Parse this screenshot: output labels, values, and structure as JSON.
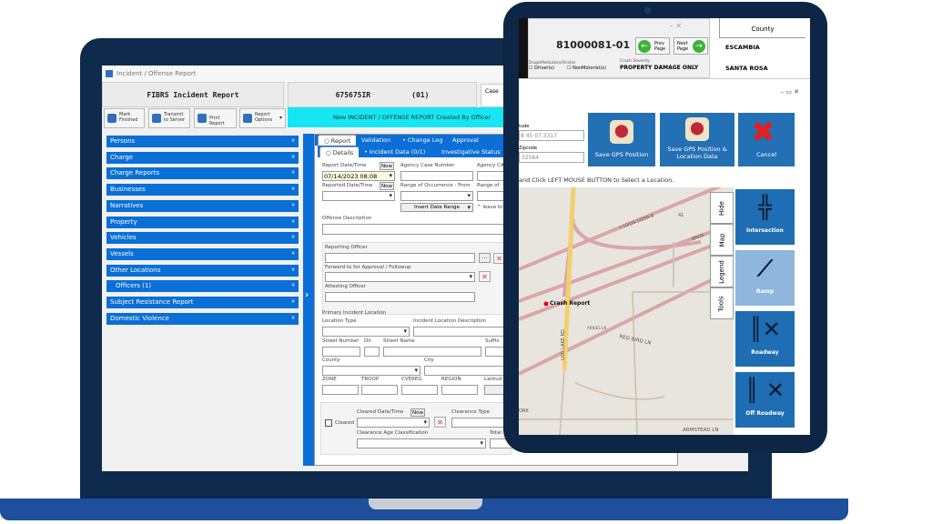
{
  "laptop_app": {
    "window_title": "Incident / Offense Report",
    "report_type": "FIBRS Incident Report",
    "report_number": "675675IR",
    "report_seq": "(01)",
    "case_label": "Case",
    "toolbar": {
      "mark_finished": "Mark Finished",
      "transmit": "Transmit to Server",
      "print": "Print Report",
      "options": "Report Options"
    },
    "banner": "New INCIDENT / OFFENSE REPORT Created By Officer",
    "sections": [
      "Persons",
      "Charge",
      "Charge Reports",
      "Businesses",
      "Narratives",
      "Property",
      "Vehicles",
      "Vessels",
      "Other Locations",
      "Officers (1)",
      "Subject Resistance Report",
      "Domestic Violence"
    ],
    "tabs": [
      "Report",
      "Validation",
      "Change Log",
      "Approval"
    ],
    "subtabs": [
      "Details",
      "Incident Data (0/1)",
      "Investigative Status"
    ],
    "form": {
      "report_datetime_label": "Report Date/Time",
      "report_datetime": "07/14/2023 08:08",
      "now": "Now",
      "agency_case_label": "Agency Case Number",
      "agency_ca_label": "Agency CA",
      "reported_datetime_label": "Reported Date/Time",
      "range_from_label": "Range of Occurrence - From",
      "range_to_label": "Range of",
      "insert_date_range": "Insert Date Range",
      "leave_blank": "^ leave bl",
      "offense_desc_label": "Offense Description",
      "reporting_officer_label": "Reporting Officer",
      "ellipsis": "...",
      "forward_label": "Forward to for Approval / Followup",
      "attesting_label": "Attesting Officer",
      "primary_location_label": "Primary Incident Location",
      "location_type_label": "Location Type",
      "location_desc_label": "Incident Location Description",
      "street_number_label": "Street Number",
      "dir_label": "Dir",
      "street_name_label": "Street Name",
      "suffix_label": "Suffix",
      "county_label": "County",
      "city_label": "City",
      "zone_label": "ZONE",
      "troop_label": "TROOP",
      "cvereg_label": "CVEREG",
      "region_label": "REGION",
      "latitude_label": "Latitud",
      "cleared_label": "Cleared",
      "cleared_datetime_label": "Cleared Date/Time",
      "clearance_type_label": "Clearance Type",
      "clearance_age_label": "Clearance Age Classification",
      "total_label": "Total"
    }
  },
  "tablet_app": {
    "report_number": "81000081-01",
    "prev_page": "Prev Page",
    "next_page": "Next Page",
    "drug_label": "Drugs/Medication/Alcohol",
    "driver": "Driver(s)",
    "nonmotorist": "NonMotorist(s)",
    "crash_severity_label": "Crash Severity",
    "crash_severity": "PROPERTY DAMAGE ONLY",
    "county_header": "County",
    "counties": [
      "ESCAMBIA",
      "SANTA ROSA"
    ],
    "longitude_label": "tude",
    "longitude": "8 45 07.3317",
    "zipcode_label": "Zipcode",
    "zipcode": "32564",
    "save_gps": "Save GPS Position",
    "save_gps_location": "Save GPS Position & Location Data",
    "cancel": "Cancel",
    "instruction": "and Click LEFT MOUSE BUTTON to Select a Location.",
    "map_tabs": [
      "Hide",
      "Map",
      "Legend",
      "Tools"
    ],
    "map_labels": {
      "marker": "Crash Report",
      "road1": "I-10/US-10/SR-8",
      "road2": "LOG LAKE RD",
      "road3": "RED BIRD LN",
      "road4": "ARNIES LN",
      "road5": "ARMSTEAD LN",
      "road6": "BROX",
      "road7": "ORK",
      "road8": "41"
    },
    "tiles": [
      "Intersection",
      "Ramp",
      "Roadway",
      "Off Roadway"
    ]
  },
  "colors": {
    "nav_blue": "#0a6fd6",
    "banner": "#16e6f2",
    "tile_blue": "#1f6db3",
    "bezel": "#0e2a4c"
  }
}
